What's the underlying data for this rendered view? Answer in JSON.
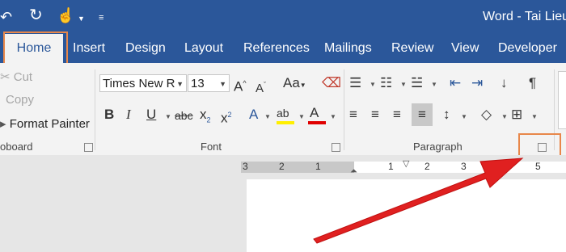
{
  "window": {
    "title": "Word - Tai Lieu"
  },
  "quick_access": {
    "undo_icon": "undo-icon",
    "redo_icon": "redo-icon",
    "touch_icon": "touch-mode-icon",
    "customize_icon": "customize-icon"
  },
  "tabs": [
    {
      "label": "Home",
      "active": true
    },
    {
      "label": "Insert"
    },
    {
      "label": "Design"
    },
    {
      "label": "Layout"
    },
    {
      "label": "References"
    },
    {
      "label": "Mailings"
    },
    {
      "label": "Review"
    },
    {
      "label": "View"
    },
    {
      "label": "Developer"
    }
  ],
  "clipboard": {
    "cut": "Cut",
    "copy": "Copy",
    "format_painter": "Format Painter",
    "group_label": "oboard"
  },
  "font": {
    "name": "Times New R",
    "size": "13",
    "group_label": "Font"
  },
  "paragraph": {
    "group_label": "Paragraph"
  },
  "ruler": {
    "labels": [
      "3",
      "2",
      "1",
      "1",
      "2",
      "3",
      "5"
    ]
  },
  "colors": {
    "accent": "#2b579a",
    "highlight_box": "#e8874a",
    "arrow": "#e02020"
  }
}
